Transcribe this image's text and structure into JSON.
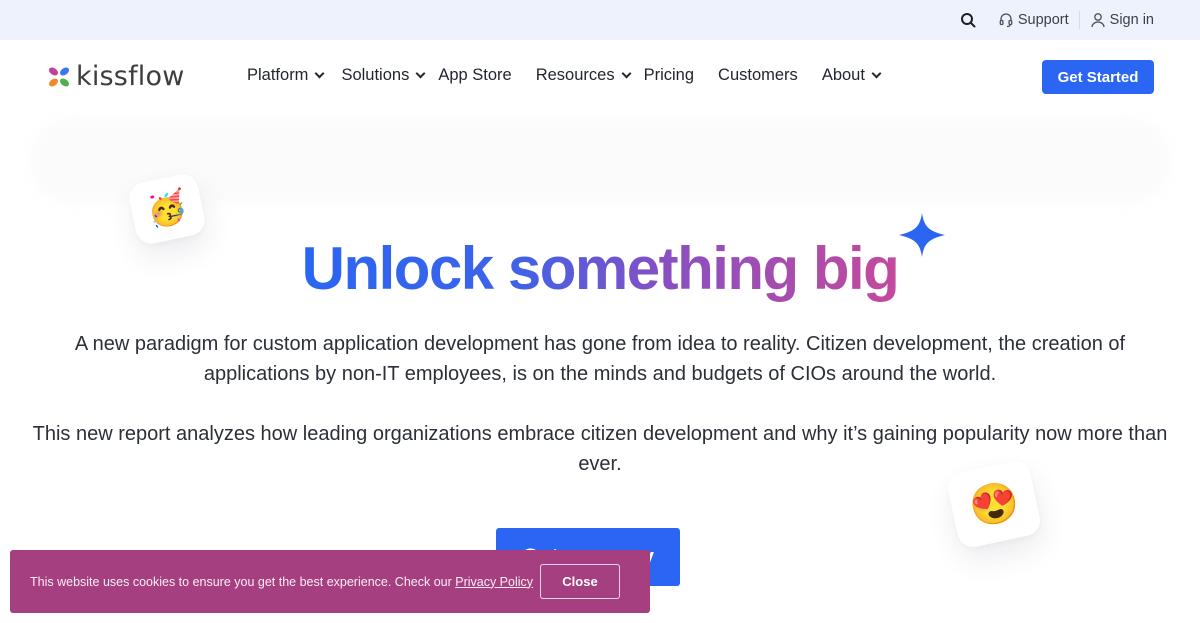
{
  "utility_bar": {
    "support_label": "Support",
    "signin_label": "Sign in"
  },
  "nav": {
    "logo_text": "kissflow",
    "links": [
      {
        "label": "Platform",
        "has_dropdown": true
      },
      {
        "label": "Solutions",
        "has_dropdown": true
      },
      {
        "label": "App Store",
        "has_dropdown": false
      },
      {
        "label": "Resources",
        "has_dropdown": true
      },
      {
        "label": "Pricing",
        "has_dropdown": false
      },
      {
        "label": "Customers",
        "has_dropdown": false
      },
      {
        "label": "About",
        "has_dropdown": true
      }
    ],
    "cta_label": "Get Started"
  },
  "hero": {
    "title": "Unlock something big",
    "paragraph_1": "A new paradigm for custom application development has gone from idea to reality. Citizen development, the creation of applications by non-IT employees, is on the minds and budgets of CIOs around the world.",
    "paragraph_2": "This new report analyzes how leading organizations embrace citizen development and why it’s gaining popularity now more than ever.",
    "cta_label": "Get my copy",
    "emoji_party": "🥳",
    "emoji_love": "😍"
  },
  "cookie_banner": {
    "text": "This website uses cookies to ensure you get the best experience. Check our ",
    "link_label": "Privacy Policy",
    "close_label": "Close"
  },
  "colors": {
    "brand_blue": "#2a66f3",
    "cookie_bg": "#a53f7f",
    "gradient_end": "#c44a9c",
    "utility_bg": "#eef2fc"
  }
}
